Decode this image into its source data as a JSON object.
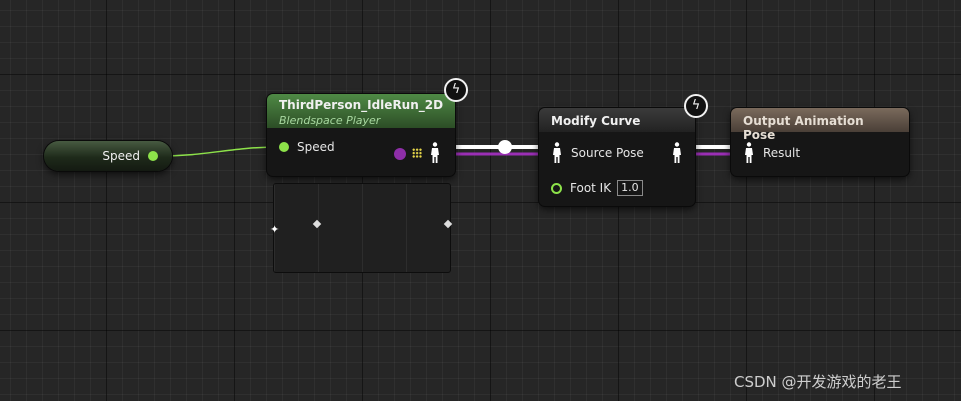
{
  "speed_getter": {
    "label": "Speed"
  },
  "blendspace_node": {
    "title": "ThirdPerson_IdleRun_2D",
    "subtitle": "Blendspace Player",
    "input_label": "Speed"
  },
  "modify_curve_node": {
    "title": "Modify Curve",
    "source_pose_label": "Source Pose",
    "foot_ik_label": "Foot IK",
    "foot_ik_value": "1.0"
  },
  "output_pose_node": {
    "title": "Output Animation Pose",
    "result_label": "Result"
  },
  "icons": {
    "fast_path": "lightning-bolt-icon",
    "pose_pin": "mannequin-icon",
    "float_pin": "circle-pin-icon"
  },
  "colors": {
    "float_pin": "#8de24a",
    "pose_wire": "#ffffff",
    "exec_wire": "#9b2fb5",
    "blendspace_header": "#3f6b38",
    "output_header": "#5e5248"
  },
  "watermark": "CSDN @开发游戏的老王"
}
